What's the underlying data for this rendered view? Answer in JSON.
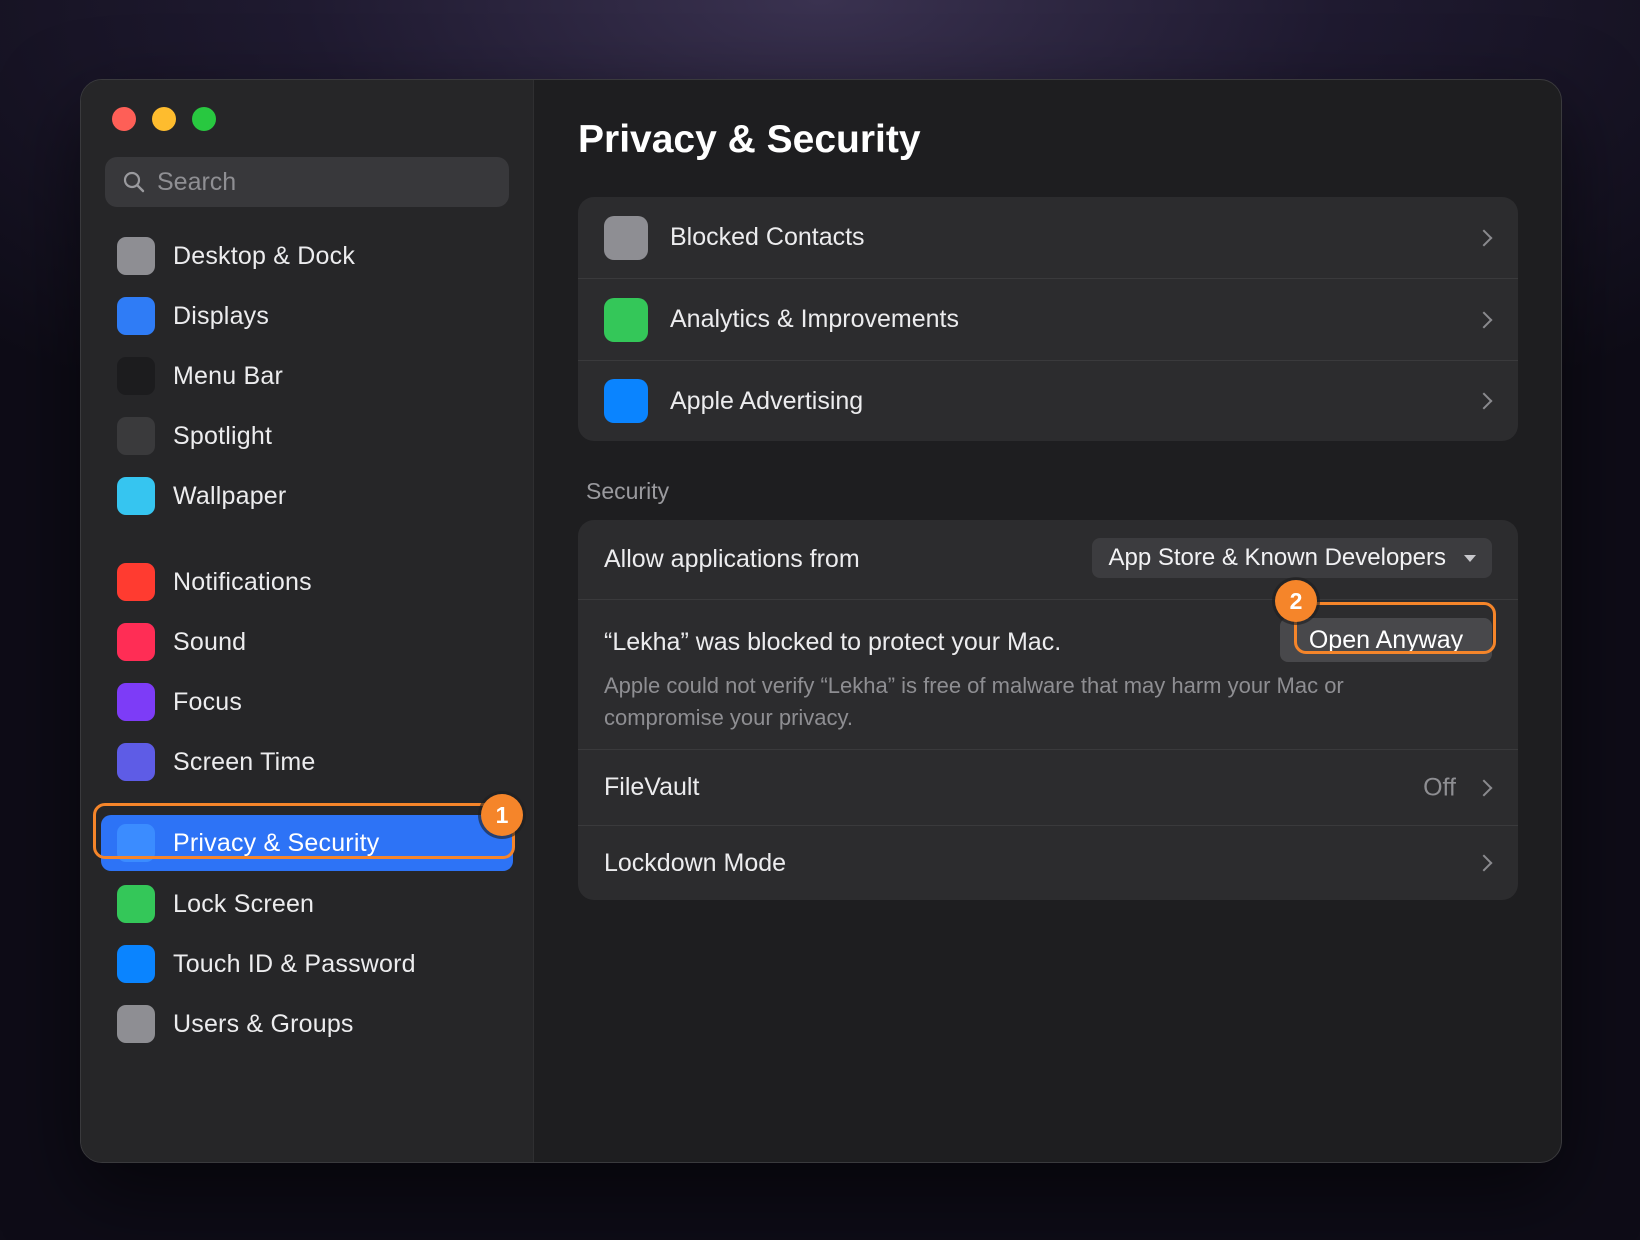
{
  "sidebar": {
    "search_placeholder": "Search",
    "group1": [
      {
        "label": "Desktop & Dock",
        "color": "#8e8e93"
      },
      {
        "label": "Displays",
        "color": "#2f7cf6"
      },
      {
        "label": "Menu Bar",
        "color": "#1c1c1e"
      },
      {
        "label": "Spotlight",
        "color": "#3a3a3c"
      },
      {
        "label": "Wallpaper",
        "color": "#36c5f0"
      }
    ],
    "group2": [
      {
        "label": "Notifications",
        "color": "#ff3b30"
      },
      {
        "label": "Sound",
        "color": "#ff2d55"
      },
      {
        "label": "Focus",
        "color": "#7d3cf7"
      },
      {
        "label": "Screen Time",
        "color": "#5e5ce6"
      }
    ],
    "selected": {
      "label": "Privacy & Security",
      "color": "#3b8cff"
    },
    "group3": [
      {
        "label": "Lock Screen",
        "color": "#34c759"
      },
      {
        "label": "Touch ID & Password",
        "color": "#0a84ff"
      },
      {
        "label": "Users & Groups",
        "color": "#8e8e93"
      }
    ]
  },
  "main": {
    "title": "Privacy & Security",
    "privacy_rows": [
      {
        "label": "Blocked Contacts",
        "color": "#8e8e93"
      },
      {
        "label": "Analytics & Improvements",
        "color": "#34c759"
      },
      {
        "label": "Apple Advertising",
        "color": "#0a84ff"
      }
    ],
    "security_header": "Security",
    "security": {
      "allow_label": "Allow applications from",
      "allow_value": "App Store & Known Developers",
      "blocked_title": "“Lekha” was blocked to protect your Mac.",
      "blocked_desc": "Apple could not verify “Lekha” is free of malware that may harm your Mac or compromise your privacy.",
      "open_anyway": "Open Anyway",
      "filevault_label": "FileVault",
      "filevault_value": "Off",
      "lockdown_label": "Lockdown Mode"
    }
  },
  "annotations": {
    "step1": "1",
    "step2": "2",
    "accent": "#f5852a"
  }
}
